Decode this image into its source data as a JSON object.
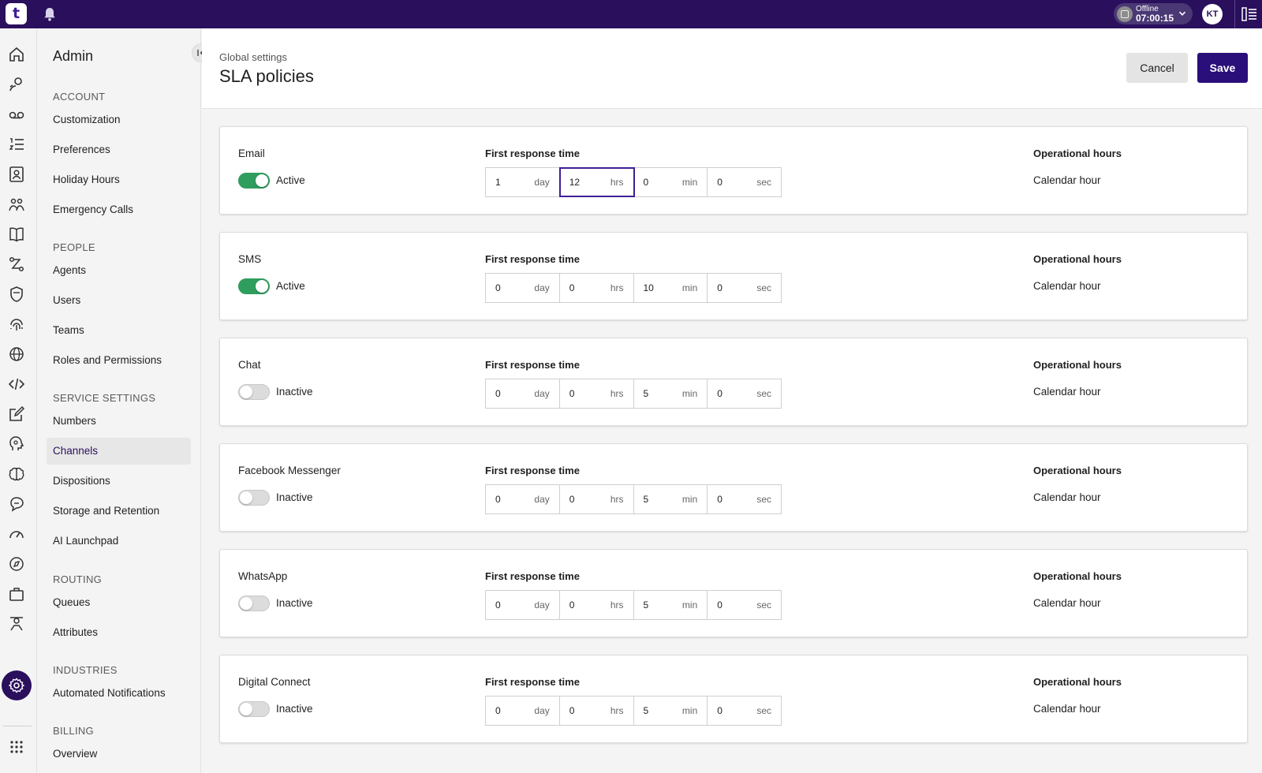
{
  "topbar": {
    "logo": "t",
    "status_label": "Offline",
    "status_time": "07:00:15",
    "avatar_initials": "KT"
  },
  "sidebar": {
    "title": "Admin",
    "sections": [
      {
        "heading": "ACCOUNT",
        "items": [
          "Customization",
          "Preferences",
          "Holiday Hours",
          "Emergency Calls"
        ]
      },
      {
        "heading": "PEOPLE",
        "items": [
          "Agents",
          "Users",
          "Teams",
          "Roles and Permissions"
        ]
      },
      {
        "heading": "SERVICE SETTINGS",
        "items": [
          "Numbers",
          "Channels",
          "Dispositions",
          "Storage and Retention",
          "AI Launchpad"
        ]
      },
      {
        "heading": "ROUTING",
        "items": [
          "Queues",
          "Attributes"
        ]
      },
      {
        "heading": "INDUSTRIES",
        "items": [
          "Automated Notifications"
        ]
      },
      {
        "heading": "BILLING",
        "items": [
          "Overview"
        ]
      }
    ],
    "active_item": "Channels"
  },
  "header": {
    "breadcrumb": "Global settings",
    "title": "SLA policies",
    "cancel_label": "Cancel",
    "save_label": "Save"
  },
  "labels": {
    "first_response": "First response time",
    "operational_hours": "Operational hours",
    "unit_day": "day",
    "unit_hrs": "hrs",
    "unit_min": "min",
    "unit_sec": "sec"
  },
  "channels": [
    {
      "name": "Email",
      "active": true,
      "status": "Active",
      "day": "1",
      "hrs": "12",
      "min": "0",
      "sec": "0",
      "op_hours": "Calendar hour"
    },
    {
      "name": "SMS",
      "active": true,
      "status": "Active",
      "day": "0",
      "hrs": "0",
      "min": "10",
      "sec": "0",
      "op_hours": "Calendar hour"
    },
    {
      "name": "Chat",
      "active": false,
      "status": "Inactive",
      "day": "0",
      "hrs": "0",
      "min": "5",
      "sec": "0",
      "op_hours": "Calendar hour"
    },
    {
      "name": "Facebook Messenger",
      "active": false,
      "status": "Inactive",
      "day": "0",
      "hrs": "0",
      "min": "5",
      "sec": "0",
      "op_hours": "Calendar hour"
    },
    {
      "name": "WhatsApp",
      "active": false,
      "status": "Inactive",
      "day": "0",
      "hrs": "0",
      "min": "5",
      "sec": "0",
      "op_hours": "Calendar hour"
    },
    {
      "name": "Digital Connect",
      "active": false,
      "status": "Inactive",
      "day": "0",
      "hrs": "0",
      "min": "5",
      "sec": "0",
      "op_hours": "Calendar hour"
    }
  ],
  "colors": {
    "brand": "#2a0f5c",
    "toggle_on": "#2e9d5d",
    "focus": "#3e1e97"
  }
}
